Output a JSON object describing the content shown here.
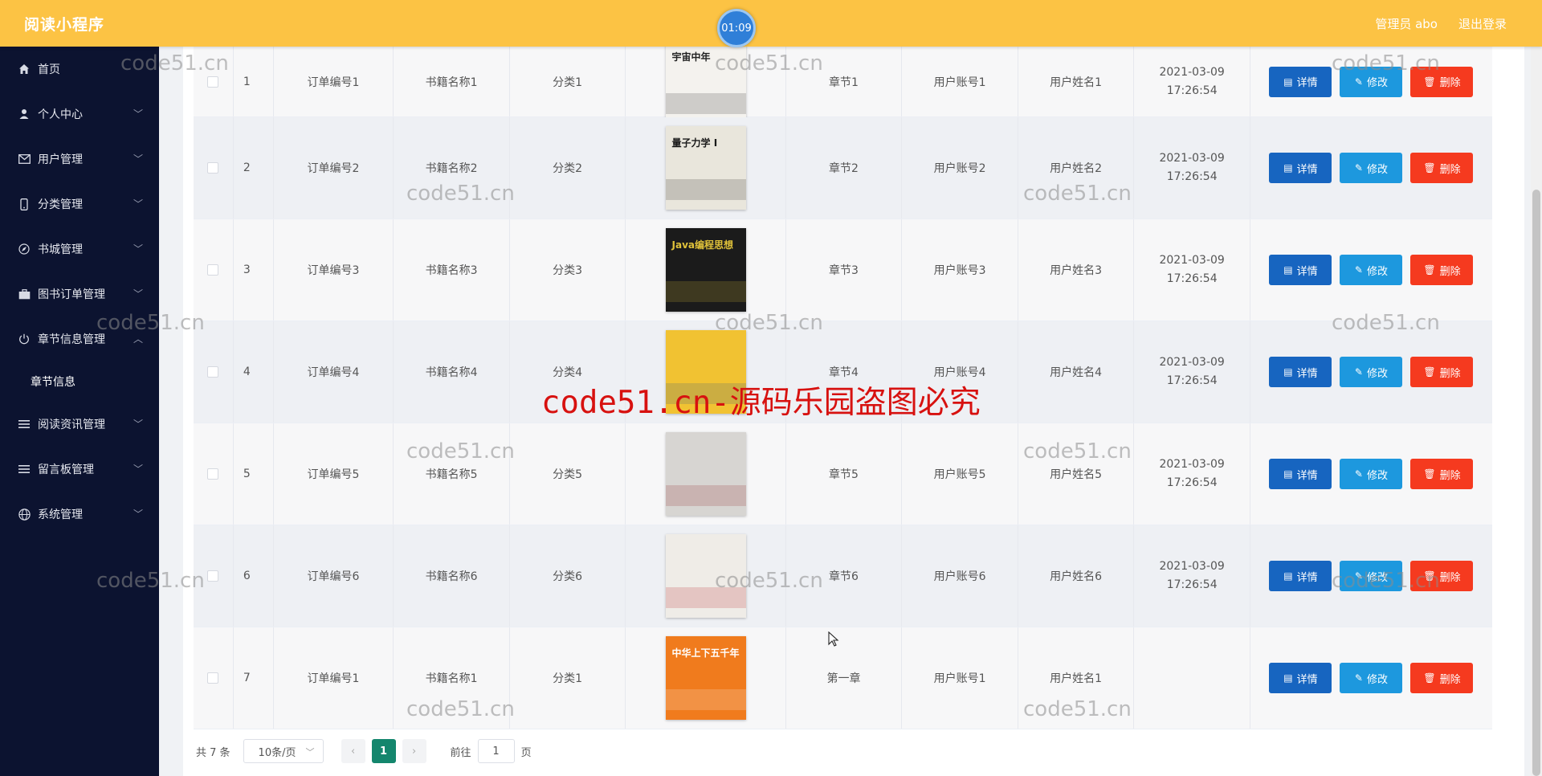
{
  "app": {
    "title": "阅读小程序",
    "timer": "01:09"
  },
  "header": {
    "admin": "管理员 abo",
    "logout": "退出登录"
  },
  "sidebar": {
    "items": [
      {
        "label": "首页",
        "icon": "home-icon"
      },
      {
        "label": "个人中心",
        "icon": "user-icon"
      },
      {
        "label": "用户管理",
        "icon": "mail-icon"
      },
      {
        "label": "分类管理",
        "icon": "phone-icon"
      },
      {
        "label": "书城管理",
        "icon": "compass-icon"
      },
      {
        "label": "图书订单管理",
        "icon": "briefcase-icon"
      },
      {
        "label": "章节信息管理",
        "icon": "power-icon"
      },
      {
        "label": "阅读资讯管理",
        "icon": "list-icon"
      },
      {
        "label": "留言板管理",
        "icon": "list-icon"
      },
      {
        "label": "系统管理",
        "icon": "globe-icon"
      }
    ],
    "sub_item": "章节信息"
  },
  "table": {
    "rows": [
      {
        "idx": "1",
        "order": "订单编号1",
        "book": "书籍名称1",
        "category": "分类1",
        "chapter": "章节1",
        "account": "用户账号1",
        "name": "用户姓名1",
        "time": "2021-03-09 17:26:54"
      },
      {
        "idx": "2",
        "order": "订单编号2",
        "book": "书籍名称2",
        "category": "分类2",
        "chapter": "章节2",
        "account": "用户账号2",
        "name": "用户姓名2",
        "time": "2021-03-09 17:26:54"
      },
      {
        "idx": "3",
        "order": "订单编号3",
        "book": "书籍名称3",
        "category": "分类3",
        "chapter": "章节3",
        "account": "用户账号3",
        "name": "用户姓名3",
        "time": "2021-03-09 17:26:54"
      },
      {
        "idx": "4",
        "order": "订单编号4",
        "book": "书籍名称4",
        "category": "分类4",
        "chapter": "章节4",
        "account": "用户账号4",
        "name": "用户姓名4",
        "time": "2021-03-09 17:26:54"
      },
      {
        "idx": "5",
        "order": "订单编号5",
        "book": "书籍名称5",
        "category": "分类5",
        "chapter": "章节5",
        "account": "用户账号5",
        "name": "用户姓名5",
        "time": "2021-03-09 17:26:54"
      },
      {
        "idx": "6",
        "order": "订单编号6",
        "book": "书籍名称6",
        "category": "分类6",
        "chapter": "章节6",
        "account": "用户账号6",
        "name": "用户姓名6",
        "time": "2021-03-09 17:26:54"
      },
      {
        "idx": "7",
        "order": "订单编号1",
        "book": "书籍名称1",
        "category": "分类1",
        "chapter": "第一章",
        "account": "用户账号1",
        "name": "用户姓名1",
        "time": ""
      }
    ],
    "actions": {
      "detail": "详情",
      "edit": "修改",
      "delete": "删除"
    }
  },
  "covers": [
    {
      "text": "宇宙中年",
      "bg": "#f4f2ee",
      "fg": "#222"
    },
    {
      "text": "量子力学 I",
      "bg": "#e9e6dc",
      "fg": "#1a1a1a"
    },
    {
      "text": "Java编程思想",
      "bg": "#1b1b1b",
      "fg": "#e0c23a"
    },
    {
      "text": "",
      "bg": "#f1c232",
      "fg": "#1f4e8c"
    },
    {
      "text": "",
      "bg": "#d7d5d2",
      "fg": "#8a1c1c"
    },
    {
      "text": "",
      "bg": "#efece7",
      "fg": "#b3151b"
    },
    {
      "text": "中华上下五千年",
      "bg": "#f07b1d",
      "fg": "#fff"
    }
  ],
  "pagination": {
    "total": "共 7 条",
    "page_size": "10条/页",
    "current_page": "1",
    "goto_prefix": "前往",
    "goto_value": "1",
    "goto_suffix": "页"
  },
  "watermark": {
    "small": "code51.cn",
    "banner": "code51.cn-源码乐园盗图必究"
  },
  "colors": {
    "topbar": "#fcc344",
    "sidebar": "#0c1330",
    "detail_button": "#1765c0",
    "edit_button": "#1d98de",
    "delete_button": "#f53a1f",
    "pager_active": "#14866d"
  }
}
